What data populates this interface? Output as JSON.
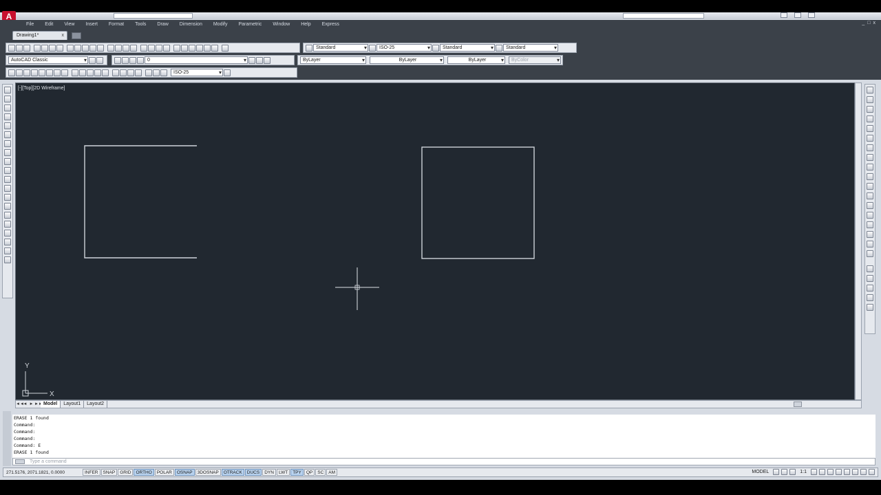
{
  "app": {
    "logo_text": "A",
    "menu": [
      "File",
      "Edit",
      "View",
      "Insert",
      "Format",
      "Tools",
      "Draw",
      "Dimension",
      "Modify",
      "Parametric",
      "Window",
      "Help",
      "Express"
    ],
    "menu_right": [
      "_",
      "□",
      "x"
    ]
  },
  "doc_tabs": [
    {
      "label": "Drawing1*",
      "close": "x"
    }
  ],
  "toolbars": {
    "styles": {
      "text_style": "Standard",
      "dim_style": "ISO-25",
      "table_style": "Standard",
      "multileader_style": "Standard"
    },
    "workspace": "AutoCAD Classic",
    "layer": "0",
    "color": "ByLayer",
    "linetype": "ByLayer",
    "lineweight": "ByLayer",
    "plot_style": "ByColor",
    "dim_style_2": "ISO-25"
  },
  "viewport": {
    "label": "[-][Top][2D Wireframe]",
    "ucs_y": "Y",
    "ucs_x": "X",
    "colors": {
      "background": "#212830",
      "geometry": "#cfd4da",
      "crosshair": "#dfe3e8"
    }
  },
  "layout_tabs": {
    "arrows": [
      "◄◄",
      "◄",
      "►",
      "►►"
    ],
    "tabs": [
      {
        "label": "Model",
        "active": true
      },
      {
        "label": "Layout1",
        "active": false
      },
      {
        "label": "Layout2",
        "active": false
      }
    ]
  },
  "command": {
    "history": [
      "ERASE 1 found",
      "Command:",
      "Command:",
      "Command:",
      "Command: E",
      "ERASE 1 found"
    ],
    "prompt_placeholder": "Type a command"
  },
  "status": {
    "coordinates": "271.5176, 2071.1821, 0.0000",
    "toggles": [
      {
        "label": "INFER",
        "on": false
      },
      {
        "label": "SNAP",
        "on": false
      },
      {
        "label": "GRID",
        "on": false
      },
      {
        "label": "ORTHO",
        "on": true
      },
      {
        "label": "POLAR",
        "on": false
      },
      {
        "label": "OSNAP",
        "on": true
      },
      {
        "label": "3DOSNAP",
        "on": false
      },
      {
        "label": "OTRACK",
        "on": true
      },
      {
        "label": "DUCS",
        "on": true
      },
      {
        "label": "DYN",
        "on": false
      },
      {
        "label": "LWT",
        "on": false
      },
      {
        "label": "TPY",
        "on": true
      },
      {
        "label": "QP",
        "on": false
      },
      {
        "label": "SC",
        "on": false
      },
      {
        "label": "AM",
        "on": false
      }
    ],
    "space": "MODEL",
    "scale": "1:1"
  }
}
